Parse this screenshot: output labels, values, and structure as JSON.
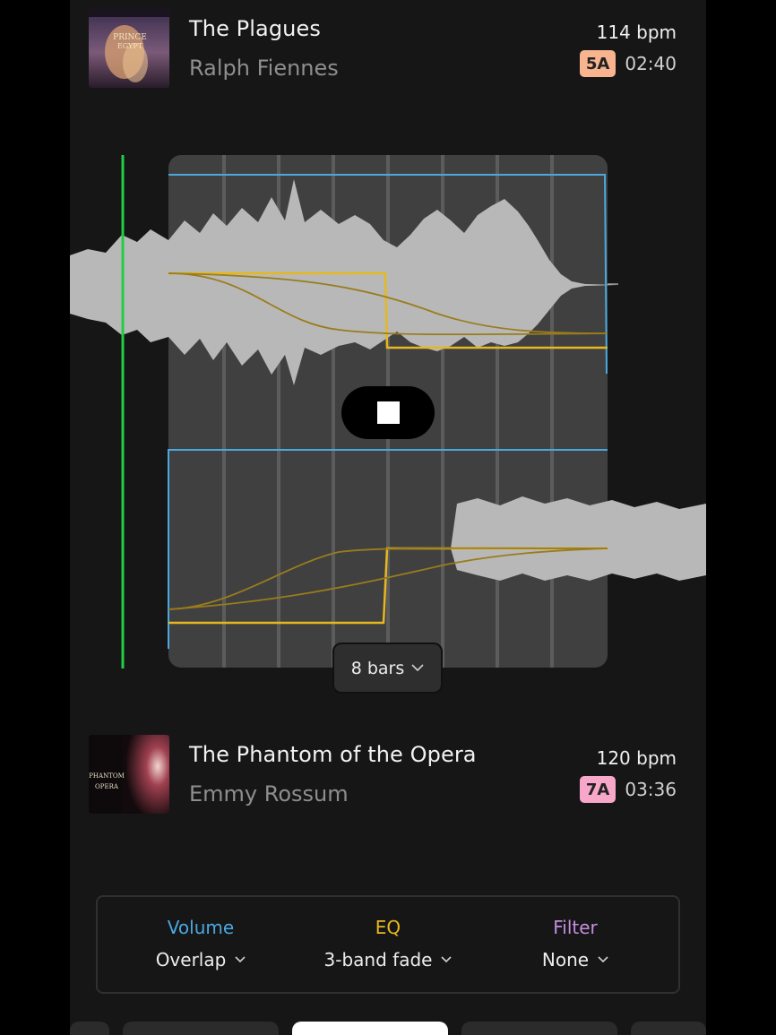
{
  "track_from": {
    "title": "The Plagues",
    "artist": "Ralph Fiennes",
    "bpm": "114 bpm",
    "key": "5A",
    "key_color": "#f7b48f",
    "duration": "02:40",
    "artwork_icon": "album-art-prince-of-egypt"
  },
  "track_to": {
    "title": "The Phantom of the Opera",
    "artist": "Emmy Rossum",
    "bpm": "120 bpm",
    "key": "7A",
    "key_color": "#f7a7c9",
    "duration": "03:36",
    "artwork_icon": "album-art-phantom-of-the-opera"
  },
  "transition": {
    "bars_label": "8 bars",
    "play_state": "playing",
    "colors": {
      "volume_line": "#4aa8e0",
      "eq_line": "#e6b820",
      "cue_marker": "#22cc44",
      "waveform": "#b5b5b5"
    }
  },
  "controls": {
    "volume": {
      "label": "Volume",
      "value": "Overlap",
      "color": "#4aa8e0"
    },
    "eq": {
      "label": "EQ",
      "value": "3-band fade",
      "color": "#e6b820"
    },
    "filter": {
      "label": "Filter",
      "value": "None",
      "color": "#c48ee0"
    }
  }
}
